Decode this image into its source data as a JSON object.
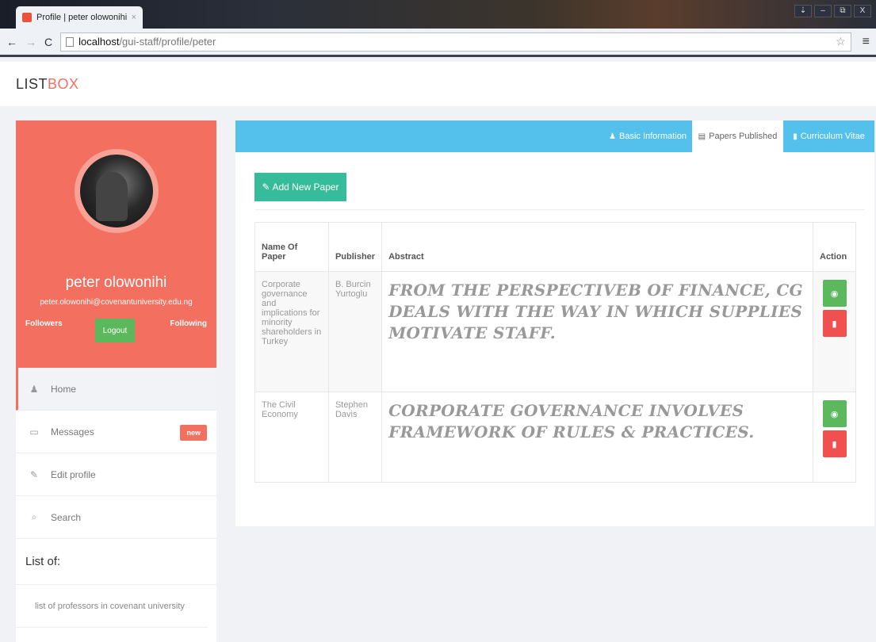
{
  "browser": {
    "tab_title": "Profile | peter olowonihi",
    "tab_close": "×",
    "url_host": "localhost",
    "url_path": "/gui-staff/profile/peter",
    "window_controls": [
      "⇣",
      "–",
      "⧉",
      "X"
    ]
  },
  "brand": {
    "part1": "LIST",
    "part2": "BOX",
    "accent": "#f36f5f"
  },
  "profile": {
    "name": "peter olowonihi",
    "email": "peter.olowonihi@covenantuniversity.edu.ng",
    "followers_label": "Followers",
    "following_label": "Following",
    "logout_label": "Logout"
  },
  "sidebar": {
    "items": [
      {
        "label": "Home",
        "icon": "user-icon",
        "glyph": "♟"
      },
      {
        "label": "Messages",
        "icon": "message-icon",
        "glyph": "▭",
        "badge": "new"
      },
      {
        "label": "Edit profile",
        "icon": "edit-icon",
        "glyph": "✎"
      },
      {
        "label": "Search",
        "icon": "search-icon",
        "glyph": "⌕"
      }
    ],
    "list_heading": "List of:",
    "list_link": "list of professors in covenant university"
  },
  "tabs": [
    {
      "label": "Basic Information",
      "icon": "user-icon",
      "glyph": "♟"
    },
    {
      "label": "Papers Published",
      "icon": "document-icon",
      "glyph": "▤"
    },
    {
      "label": "Curriculum Vitae",
      "icon": "file-icon",
      "glyph": "▮"
    }
  ],
  "papers": {
    "add_button": "Add New Paper",
    "add_glyph": "✎",
    "columns": [
      "Name Of Paper",
      "Publisher",
      "Abstract",
      "Action"
    ],
    "rows": [
      {
        "name": "Corporate governance and implications for minority shareholders in Turkey",
        "publisher": "B. Burcin Yurtoglu",
        "abstract": "From the perspectiveb of finance, CG deals with the way in which supplies motivate staff."
      },
      {
        "name": "The Civil Economy",
        "publisher": "Stephen Davis",
        "abstract": "Corporate governance involves framework of rules & practices."
      }
    ],
    "view_glyph": "◉",
    "delete_glyph": "▮"
  }
}
